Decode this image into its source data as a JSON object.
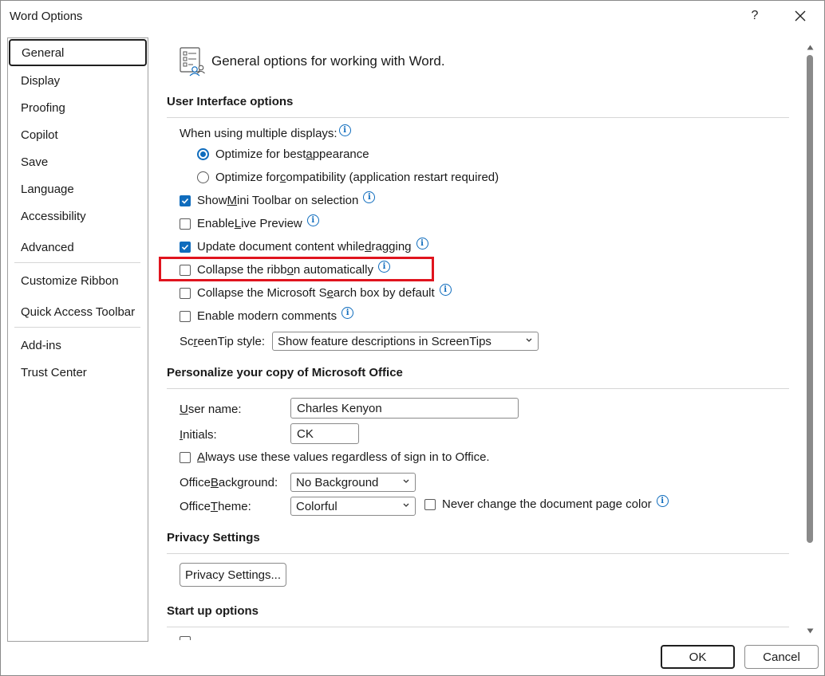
{
  "window": {
    "title": "Word Options",
    "help": "?",
    "close": "✕"
  },
  "nav": {
    "items": [
      {
        "label": "General"
      },
      {
        "label": "Display"
      },
      {
        "label": "Proofing"
      },
      {
        "label": "Copilot"
      },
      {
        "label": "Save"
      },
      {
        "label": "Language"
      },
      {
        "label": "Accessibility"
      },
      {
        "label": "Advanced"
      },
      {
        "label": "Customize Ribbon"
      },
      {
        "label": "Quick Access Toolbar"
      },
      {
        "label": "Add-ins"
      },
      {
        "label": "Trust Center"
      }
    ]
  },
  "page": {
    "heading": "General options for working with Word."
  },
  "ui_options": {
    "section_title": "User Interface options",
    "displays_label": "When using multiple displays:",
    "radio_best": {
      "pre": "Optimize for best ",
      "u": "a",
      "post": "ppearance"
    },
    "radio_compat": {
      "pre": "Optimize for ",
      "u": "c",
      "post": "ompatibility (application restart required)"
    },
    "mini_toolbar": {
      "pre": "Show ",
      "u": "M",
      "post": "ini Toolbar on selection"
    },
    "live_preview": {
      "pre": "Enable ",
      "u": "L",
      "post": "ive Preview"
    },
    "update_doc": {
      "pre": "Update document content while ",
      "u": "d",
      "post": "ragging"
    },
    "collapse_ribbon": {
      "pre": "Collapse the ribb",
      "u": "o",
      "post": "n automatically"
    },
    "collapse_search": {
      "pre": "Collapse the Microsoft S",
      "u": "e",
      "post": "arch box by default"
    },
    "modern_comments": {
      "label": "Enable modern comments"
    },
    "screentip_label": {
      "pre": "Sc",
      "u": "r",
      "post": "eenTip style:"
    },
    "screentip_value": "Show feature descriptions in ScreenTips"
  },
  "personalize": {
    "section_title": "Personalize your copy of Microsoft Office",
    "username_label": {
      "pre": "",
      "u": "U",
      "post": "ser name:"
    },
    "username_value": "Charles Kenyon",
    "initials_label": {
      "pre": "",
      "u": "I",
      "post": "nitials:"
    },
    "initials_value": "CK",
    "always_use": {
      "pre": "",
      "u": "A",
      "post": "lways use these values regardless of sign in to Office."
    },
    "background_label": {
      "pre": "Office ",
      "u": "B",
      "post": "ackground:"
    },
    "background_value": "No Background",
    "theme_label": {
      "pre": "Office ",
      "u": "T",
      "post": "heme:"
    },
    "theme_value": "Colorful",
    "never_change": "Never change the document page color"
  },
  "privacy": {
    "section_title": "Privacy Settings",
    "button_label": "Privacy Settings..."
  },
  "startup": {
    "section_title": "Start up options"
  },
  "footer": {
    "ok": "OK",
    "cancel": "Cancel"
  },
  "colors": {
    "accent": "#0f6cbd",
    "highlight": "#e0141e"
  }
}
